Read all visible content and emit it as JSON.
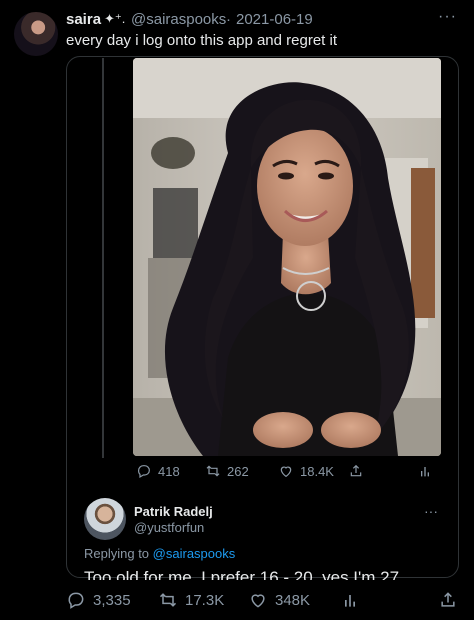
{
  "tweet": {
    "author_name": "saira",
    "author_deco": "✦⁺.",
    "author_handle": "@sairaspooks",
    "separator": "·",
    "date": "2021-06-19",
    "text": "every day i log onto this app and regret it",
    "more": "···"
  },
  "quoted": {
    "stats": {
      "replies": "418",
      "retweets": "262",
      "likes": "18.4K"
    }
  },
  "reply": {
    "author_name": "Patrik Radelj",
    "author_handle": "@yustforfun",
    "more": "···",
    "replying_prefix": "Replying to",
    "replying_handle": "@sairaspooks",
    "text": "Too old for me. I prefer 16 - 20, yes I'm 27."
  },
  "bottom_stats": {
    "replies": "3,335",
    "retweets": "17.3K",
    "likes": "348K"
  },
  "icons": [
    "reply-icon",
    "retweet-icon",
    "like-icon",
    "share-icon",
    "analytics-icon",
    "more-icon"
  ]
}
